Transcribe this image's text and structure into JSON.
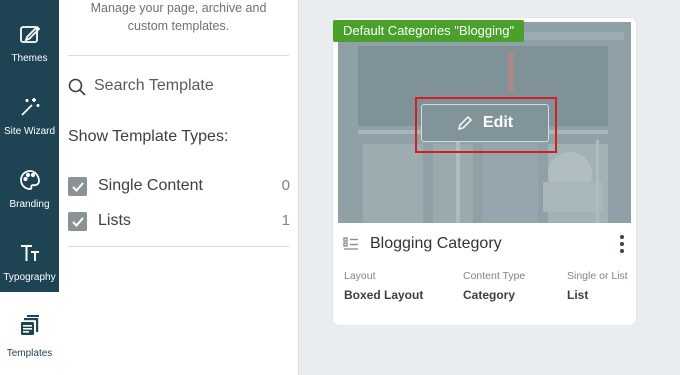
{
  "rail": {
    "items": [
      {
        "label": "Themes",
        "icon": "themes-icon"
      },
      {
        "label": "Site Wizard",
        "icon": "magic-wand-icon"
      },
      {
        "label": "Branding",
        "icon": "palette-icon"
      },
      {
        "label": "Typography",
        "icon": "typography-icon"
      },
      {
        "label": "Templates",
        "icon": "templates-icon",
        "active": true
      }
    ]
  },
  "panel": {
    "description_line1": "Manage your page, archive and",
    "description_line2": "custom templates.",
    "search_placeholder": "Search Template",
    "types_title": "Show Template Types:",
    "types": [
      {
        "label": "Single Content",
        "count": "0",
        "checked": true
      },
      {
        "label": "Lists",
        "count": "1",
        "checked": true
      }
    ]
  },
  "card": {
    "badge": "Default Categories \"Blogging\"",
    "edit_label": "Edit",
    "title": "Blogging Category",
    "meta": [
      {
        "label": "Layout",
        "value": "Boxed Layout"
      },
      {
        "label": "Content Type",
        "value": "Category"
      },
      {
        "label": "Single or List",
        "value": "List"
      }
    ]
  },
  "colors": {
    "rail_bg": "#1e4454",
    "badge_green": "#49a12b",
    "highlight_red": "#d71e1e"
  }
}
